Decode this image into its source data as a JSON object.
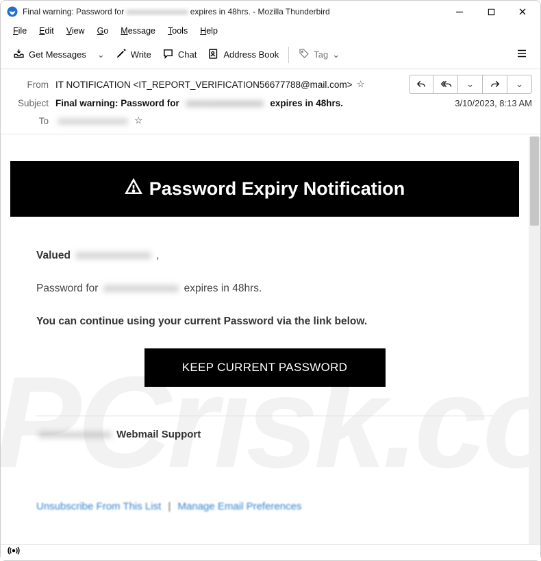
{
  "window": {
    "title_prefix": "Final warning: Password for",
    "title_blurred": "xxxxxxxxxxxxxxx",
    "title_suffix": "expires in 48hrs. - Mozilla Thunderbird"
  },
  "menu": {
    "items": [
      {
        "label": "File",
        "u": "F",
        "rest": "ile"
      },
      {
        "label": "Edit",
        "u": "E",
        "rest": "dit"
      },
      {
        "label": "View",
        "u": "V",
        "rest": "iew"
      },
      {
        "label": "Go",
        "u": "G",
        "rest": "o"
      },
      {
        "label": "Message",
        "u": "M",
        "rest": "essage"
      },
      {
        "label": "Tools",
        "u": "T",
        "rest": "ools"
      },
      {
        "label": "Help",
        "u": "H",
        "rest": "elp"
      }
    ]
  },
  "toolbar": {
    "get_messages": "Get Messages",
    "write": "Write",
    "chat": "Chat",
    "address_book": "Address Book",
    "tag": "Tag"
  },
  "headers": {
    "from_label": "From",
    "from_value": "IT NOTIFICATION <IT_REPORT_VERIFICATION56677788@mail.com>",
    "subject_label": "Subject",
    "subject_prefix": "Final warning: Password for",
    "subject_blurred": "xxxxxxxxxxxxxxx",
    "subject_suffix": "expires in 48hrs.",
    "to_label": "To",
    "to_blurred": "xxxxxxxxxxxxxxx",
    "date": "3/10/2023, 8:13 AM"
  },
  "email": {
    "banner_title": "Password Expiry Notification",
    "valued_label": "Valued",
    "valued_blurred": "xxxxxxxxxxxxxx",
    "valued_comma": " ,",
    "pw_prefix": "Password for",
    "pw_blurred": "xxxxxxxxxxxxxx",
    "pw_suffix": "expires in 48hrs.",
    "continue_line": "You can continue using your current Password via the link below.",
    "cta": "KEEP CURRENT PASSWORD",
    "sig_blurred": "xxxxxxxxxxxxxx",
    "sig_text": "Webmail Support",
    "link1": "Unsubscribe From This List",
    "link_sep": "|",
    "link2": "Manage Email Preferences"
  },
  "watermark": "PCrisk.com"
}
